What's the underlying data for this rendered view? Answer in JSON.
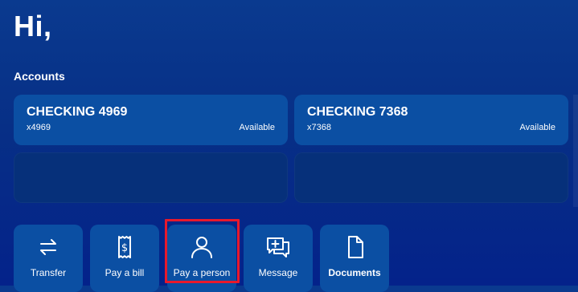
{
  "greeting": "Hi,",
  "accounts": {
    "title": "Accounts",
    "items": [
      {
        "name": "CHECKING 4969",
        "mask": "x4969",
        "available_label": "Available"
      },
      {
        "name": "CHECKING 7368",
        "mask": "x7368",
        "available_label": "Available"
      }
    ]
  },
  "actions": [
    {
      "label": "Transfer",
      "icon": "transfer-icon"
    },
    {
      "label": "Pay a bill",
      "icon": "bill-icon"
    },
    {
      "label": "Pay a person",
      "icon": "person-icon"
    },
    {
      "label": "Message",
      "icon": "message-icon"
    },
    {
      "label": "Documents",
      "icon": "document-icon"
    }
  ],
  "colors": {
    "background": "#072f86",
    "card": "#0b4fa3",
    "highlight": "#e8192c"
  }
}
